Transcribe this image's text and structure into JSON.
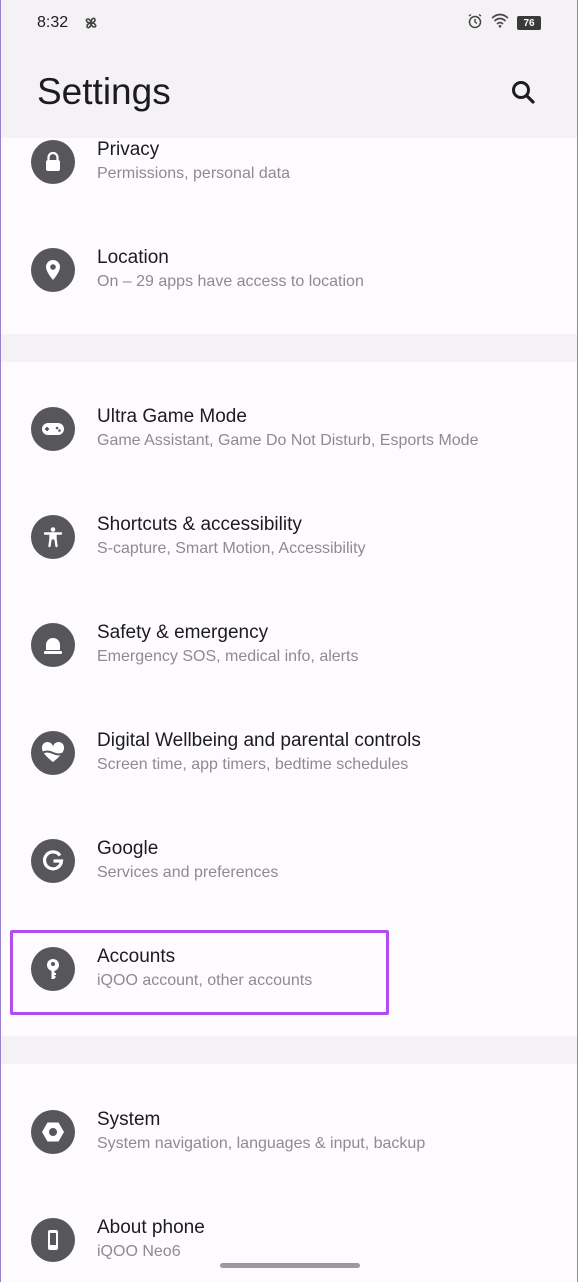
{
  "status_bar": {
    "time": "8:32",
    "battery": "76",
    "icons": [
      "pinwheel-icon",
      "alarm-icon",
      "wifi-icon",
      "battery-icon"
    ]
  },
  "header": {
    "title": "Settings",
    "search_icon": "search-icon"
  },
  "colors": {
    "icon_background": "#57575b",
    "card_background": "#fdfbfd",
    "page_background": "#f4f2f4",
    "highlight_border": "#b04cf0"
  },
  "items": [
    {
      "id": "privacy",
      "title": "Privacy",
      "subtitle": "Permissions, personal data",
      "icon": "lock-icon"
    },
    {
      "id": "location",
      "title": "Location",
      "subtitle": "On – 29 apps have access to location",
      "icon": "location-pin-icon"
    },
    {
      "id": "ultra-game-mode",
      "title": "Ultra Game Mode",
      "subtitle": "Game Assistant, Game Do Not Disturb, Esports Mode",
      "icon": "gamepad-icon"
    },
    {
      "id": "shortcuts-accessibility",
      "title": "Shortcuts & accessibility",
      "subtitle": "S-capture, Smart Motion, Accessibility",
      "icon": "accessibility-icon"
    },
    {
      "id": "safety-emergency",
      "title": "Safety & emergency",
      "subtitle": "Emergency SOS, medical info, alerts",
      "icon": "emergency-light-icon"
    },
    {
      "id": "digital-wellbeing",
      "title": "Digital Wellbeing and parental controls",
      "subtitle": "Screen time, app timers, bedtime schedules",
      "icon": "heart-icon"
    },
    {
      "id": "google",
      "title": "Google",
      "subtitle": "Services and preferences",
      "icon": "google-g-icon"
    },
    {
      "id": "accounts",
      "title": "Accounts",
      "subtitle": "iQOO account, other accounts",
      "icon": "key-icon"
    },
    {
      "id": "system",
      "title": "System",
      "subtitle": "System navigation, languages & input, backup",
      "icon": "system-hexagon-icon"
    },
    {
      "id": "about-phone",
      "title": "About phone",
      "subtitle": "iQOO Neo6",
      "icon": "phone-icon"
    }
  ]
}
